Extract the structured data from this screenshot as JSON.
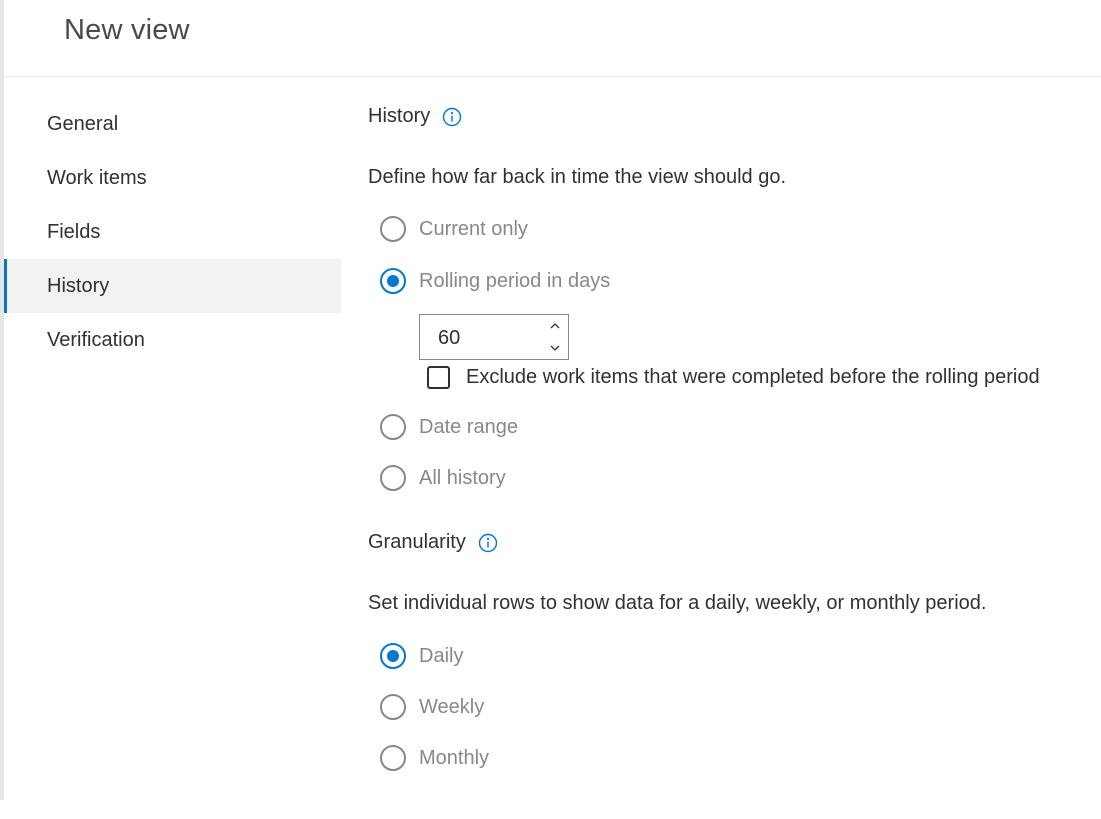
{
  "page": {
    "title": "New view"
  },
  "nav": {
    "items": [
      {
        "label": "General",
        "active": false
      },
      {
        "label": "Work items",
        "active": false
      },
      {
        "label": "Fields",
        "active": false
      },
      {
        "label": "History",
        "active": true
      },
      {
        "label": "Verification",
        "active": false
      }
    ]
  },
  "history": {
    "title": "History",
    "info_icon": "info-icon",
    "description": "Define how far back in time the view should go.",
    "options": [
      {
        "label": "Current only",
        "checked": false
      },
      {
        "label": "Rolling period in days",
        "checked": true
      },
      {
        "label": "Date range",
        "checked": false
      },
      {
        "label": "All history",
        "checked": false
      }
    ],
    "rolling_days": "60",
    "exclude_label": "Exclude work items that were completed before the rolling period",
    "exclude_checked": false
  },
  "granularity": {
    "title": "Granularity",
    "info_icon": "info-icon",
    "description": "Set individual rows to show data for a daily, weekly, or monthly period.",
    "options": [
      {
        "label": "Daily",
        "checked": true
      },
      {
        "label": "Weekly",
        "checked": false
      },
      {
        "label": "Monthly",
        "checked": false
      }
    ]
  },
  "colors": {
    "accent": "#0078d4",
    "muted_text": "#8a8886",
    "text": "#323130"
  }
}
